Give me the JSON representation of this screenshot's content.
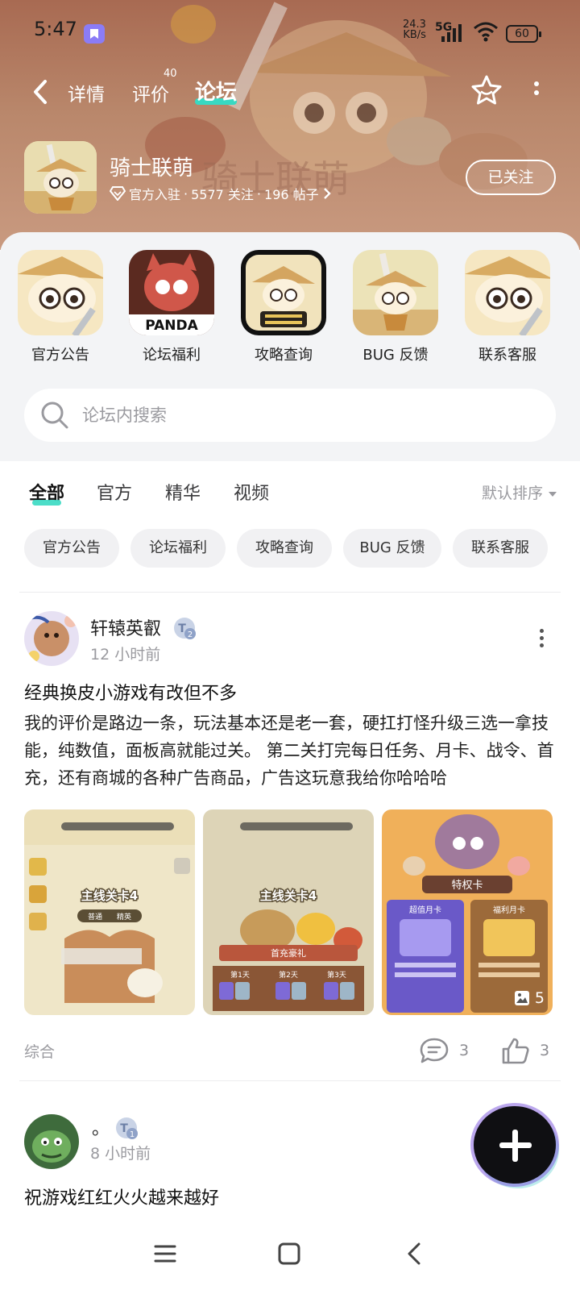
{
  "status_bar": {
    "time": "5:47",
    "network_speed_value": "24.3",
    "network_speed_unit": "KB/s",
    "network_type": "5G",
    "battery": "60"
  },
  "nav": {
    "tabs": [
      {
        "label": "详情"
      },
      {
        "label": "评价",
        "badge": "40"
      },
      {
        "label": "论坛",
        "active": true
      }
    ]
  },
  "game": {
    "name": "骑士联萌",
    "verified": "官方入驻",
    "followers": "5577 关注",
    "posts": "196 帖子",
    "follow_button": "已关注"
  },
  "shortcuts": [
    {
      "label": "官方公告"
    },
    {
      "label": "论坛福利"
    },
    {
      "label": "攻略查询"
    },
    {
      "label": "BUG 反馈"
    },
    {
      "label": "联系客服"
    }
  ],
  "search": {
    "placeholder": "论坛内搜索"
  },
  "filter_tabs": [
    {
      "label": "全部",
      "active": true
    },
    {
      "label": "官方"
    },
    {
      "label": "精华"
    },
    {
      "label": "视频"
    }
  ],
  "sort_label": "默认排序",
  "chips": [
    "官方公告",
    "论坛福利",
    "攻略查询",
    "BUG 反馈",
    "联系客服"
  ],
  "posts": [
    {
      "author": "轩辕英叡",
      "level": "2",
      "time": "12 小时前",
      "title": "经典换皮小游戏有改但不多",
      "body": "我的评价是路边一条，玩法基本还是老一套，硬扛打怪升级三选一拿技能，纯数值，面板高就能过关。 第二关打完每日任务、月卡、战令、首充，还有商城的各种广告商品，广告这玩意我给你哈哈哈",
      "images": [
        {
          "caption": "主线关卡4",
          "sub": [
            "普通",
            "精英"
          ]
        },
        {
          "caption": "主线关卡4",
          "banner": "首充豪礼",
          "days": [
            "第1天",
            "第2天",
            "第3天"
          ]
        },
        {
          "caption": "特权卡",
          "cards": [
            "超值月卡",
            "福利月卡"
          ]
        }
      ],
      "image_count": "5",
      "category": "综合",
      "comments": "3",
      "likes": "3"
    },
    {
      "author": "。",
      "level": "1",
      "time": "8 小时前",
      "title": "祝游戏红红火火越来越好"
    }
  ],
  "colors": {
    "accent": "#38d9c2",
    "header_bg": "#b07a60",
    "panel_bg": "#f3f4f6"
  }
}
